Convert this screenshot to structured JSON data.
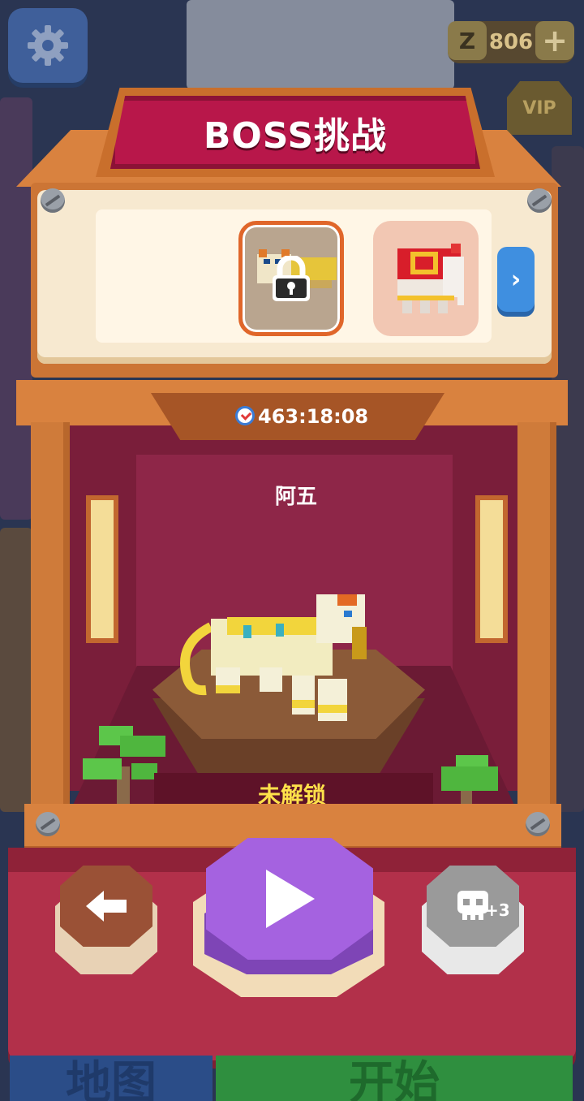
{
  "hud": {
    "coins": "806",
    "coin_symbol": "Z",
    "vip_label": "VIP"
  },
  "title": "BOSS挑战",
  "selector": {
    "slots": [
      {
        "state": "locked"
      },
      {
        "state": "available"
      }
    ]
  },
  "timer": "463:18:08",
  "boss": {
    "name": "阿五",
    "status": "未解锁"
  },
  "controls": {
    "skull_count": "+3"
  },
  "bottom_tabs": {
    "map": "地图",
    "start": "开始"
  },
  "colors": {
    "title_red": "#b8174a",
    "frame_orange": "#d9823f",
    "play_purple": "#a562e0",
    "status_yellow": "#ffe14a"
  }
}
